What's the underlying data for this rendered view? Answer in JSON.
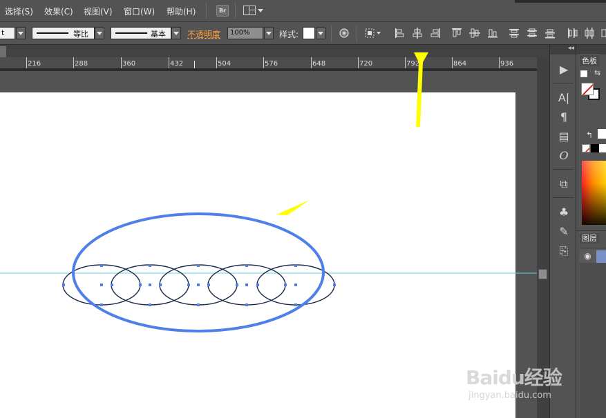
{
  "menubar": {
    "items": [
      "选择(S)",
      "效果(C)",
      "视图(V)",
      "窗口(W)",
      "帮助(H)"
    ],
    "bridge_label": "Br"
  },
  "controlbar": {
    "fill_stub_text": "t",
    "stroke_profile_label": "等比",
    "brush_label": "基本",
    "opacity_label": "不透明度",
    "opacity_value": "100%",
    "style_label": "样式:"
  },
  "ruler": {
    "labels": [
      "216",
      "288",
      "360",
      "432",
      "504",
      "576",
      "648",
      "720",
      "792",
      "864",
      "936"
    ]
  },
  "panels": {
    "color_tab": "色板",
    "layers_tab": "图层"
  },
  "icons": {
    "dock": [
      "play-icon",
      "character-icon",
      "paragraph-icon",
      "align-icon",
      "opentype-icon",
      "transform-icon",
      "symbols-icon",
      "brushes-icon",
      "export-icon"
    ],
    "align_buttons": [
      "align-left-icon",
      "align-hcenter-icon",
      "align-right-icon",
      "align-top-icon",
      "align-vcenter-icon",
      "align-bottom-icon",
      "distribute-top-icon",
      "distribute-vcenter-icon",
      "distribute-bottom-icon",
      "distribute-left-icon",
      "distribute-hcenter-icon"
    ]
  },
  "colors": {
    "ui_background": "#535353",
    "selection_blue": "#4f7fe8",
    "guide_cyan": "#5fd3e6",
    "arrow_yellow": "#ffff00",
    "opacity_label_orange": "#ff9a3c"
  },
  "watermark": {
    "logo": "Baidu经验",
    "url": "jingyan.baidu.com"
  }
}
